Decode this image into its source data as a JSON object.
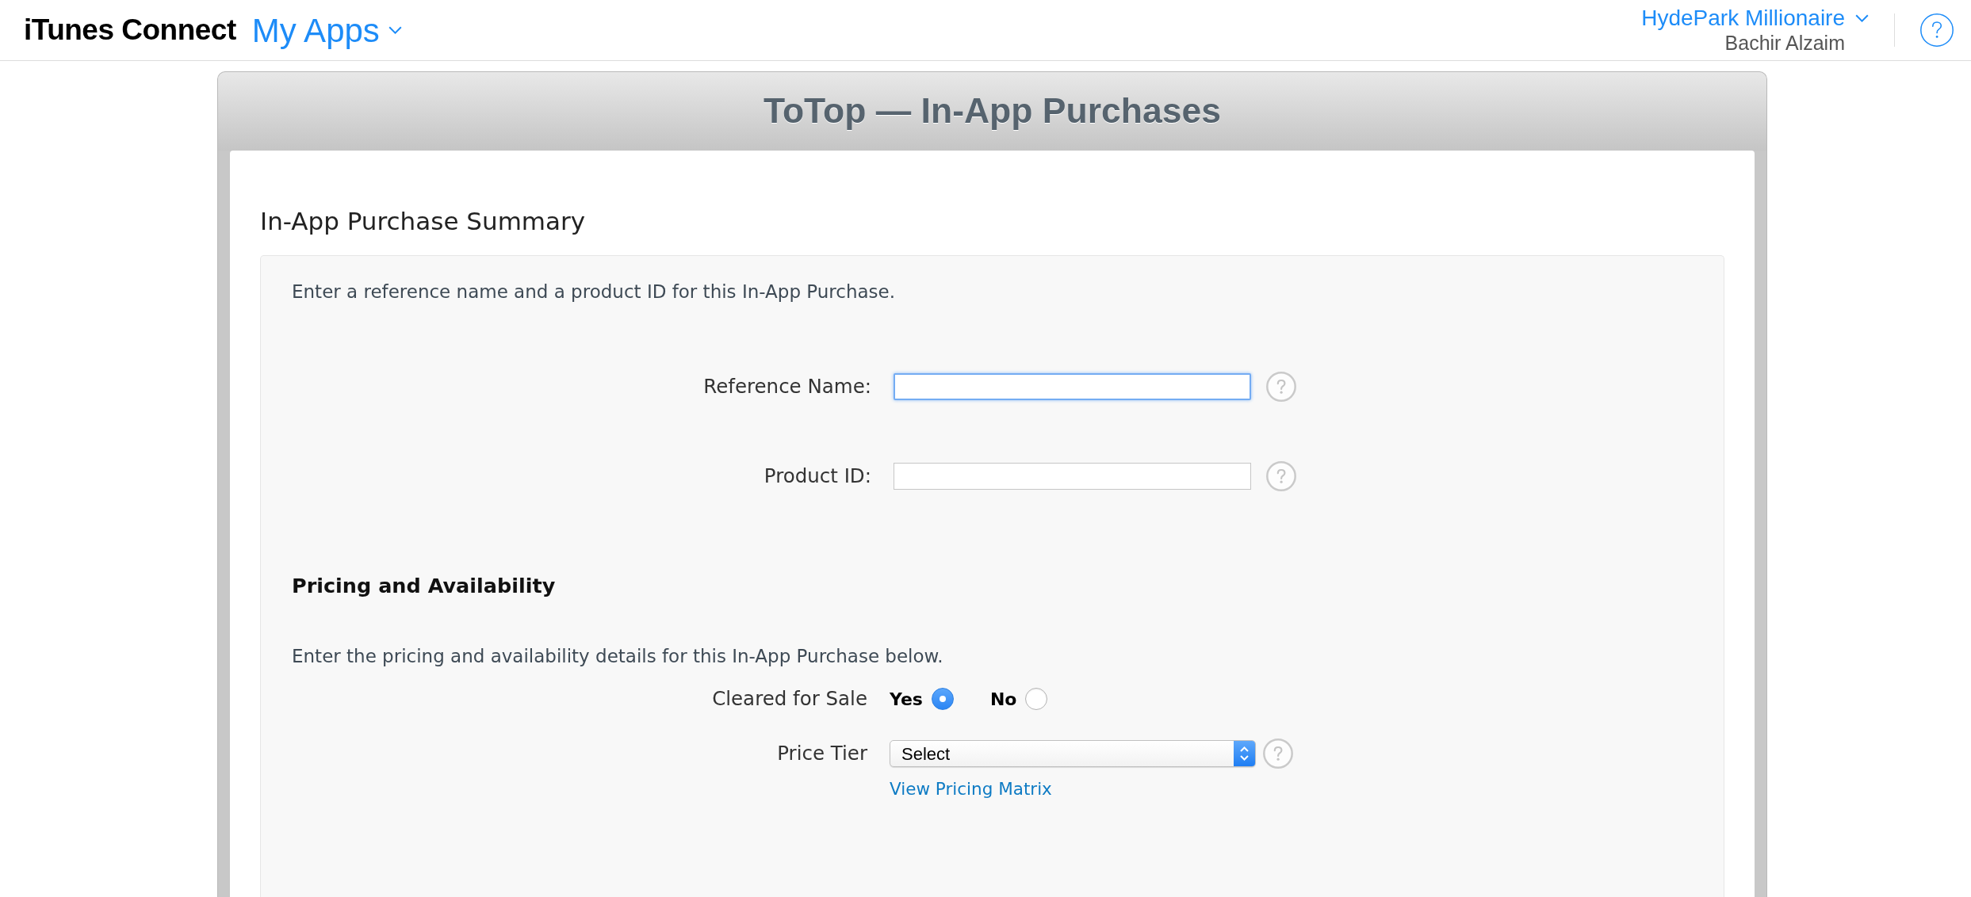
{
  "header": {
    "brand": "iTunes Connect",
    "app_menu": {
      "label": "My Apps"
    },
    "account_menu": {
      "label": "HydePark Millionaire"
    },
    "user_name": "Bachir Alzaim"
  },
  "page_title": "ToTop — In-App Purchases",
  "summary": {
    "heading": "In-App Purchase Summary",
    "intro": "Enter a reference name and a product ID for this In-App Purchase.",
    "fields": [
      {
        "label": "Reference Name:",
        "focused": true
      },
      {
        "label": "Product ID:",
        "focused": false
      }
    ]
  },
  "pricing": {
    "heading": "Pricing and Availability",
    "intro": "Enter the pricing and availability details for this In-App Purchase below.",
    "cleared_for_sale": {
      "label": "Cleared for Sale",
      "options": [
        {
          "label": "Yes",
          "selected": true
        },
        {
          "label": "No",
          "selected": false
        }
      ]
    },
    "price_tier": {
      "label": "Price Tier",
      "value": "Select"
    },
    "link": "View Pricing Matrix"
  }
}
